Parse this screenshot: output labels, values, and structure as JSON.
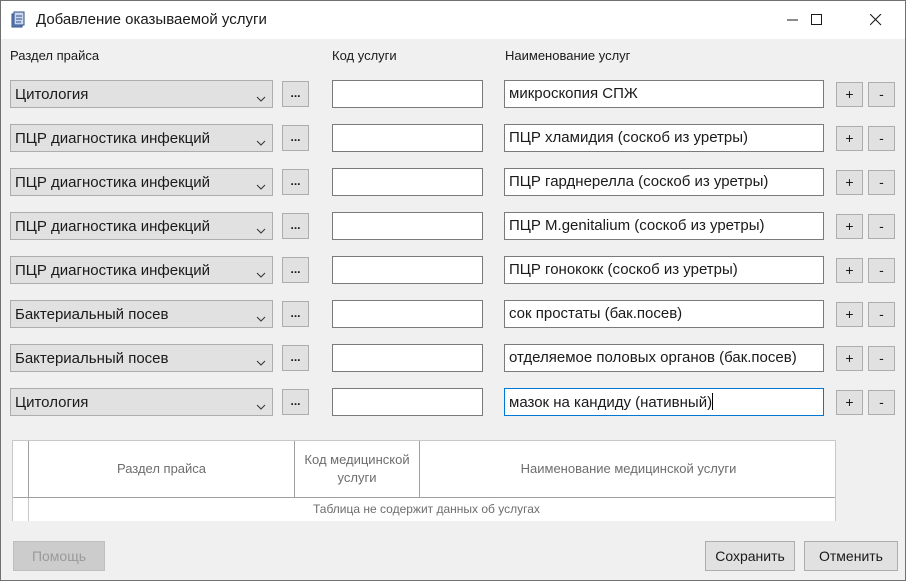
{
  "window": {
    "title": "Добавление оказываемой услуги",
    "icon": "app-icon",
    "controls": {
      "minimize": "minimize-icon",
      "maximize": "maximize-icon",
      "close": "close-icon"
    }
  },
  "column_headers": {
    "section": "Раздел прайса",
    "code": "Код услуги",
    "name": "Наименование услуг"
  },
  "rows": [
    {
      "section": "Цитология",
      "code": "",
      "name": "микроскопия СПЖ"
    },
    {
      "section": "ПЦР диагностика инфекций",
      "code": "",
      "name": "ПЦР хламидия (соскоб из уретры)"
    },
    {
      "section": "ПЦР диагностика инфекций",
      "code": "",
      "name": "ПЦР гарднерелла (соскоб из уретры)"
    },
    {
      "section": "ПЦР диагностика инфекций",
      "code": "",
      "name": "ПЦР M.genitalium (соскоб из уретры)"
    },
    {
      "section": "ПЦР диагностика инфекций",
      "code": "",
      "name": "ПЦР гонококк (соскоб из уретры)"
    },
    {
      "section": "Бактериальный посев",
      "code": "",
      "name": "сок простаты (бак.посев)"
    },
    {
      "section": "Бактериальный посев",
      "code": "",
      "name": "отделяемое половых органов (бак.посев)"
    },
    {
      "section": "Цитология",
      "code": "",
      "name": "мазок на кандиду (нативный)"
    }
  ],
  "row_buttons": {
    "browse": "...",
    "add": "+",
    "remove": "-"
  },
  "grid": {
    "columns": [
      "Раздел прайса",
      "Код медицинской услуги",
      "Наименование медицинской услуги"
    ],
    "empty_text": "Таблица не содержит данных об услугах"
  },
  "buttons": {
    "help": "Помощь",
    "save": "Сохранить",
    "cancel": "Отменить"
  },
  "colors": {
    "accent_focus": "#0078d7",
    "button_face": "#e1e1e1",
    "window_bg": "#f0f0f0"
  }
}
